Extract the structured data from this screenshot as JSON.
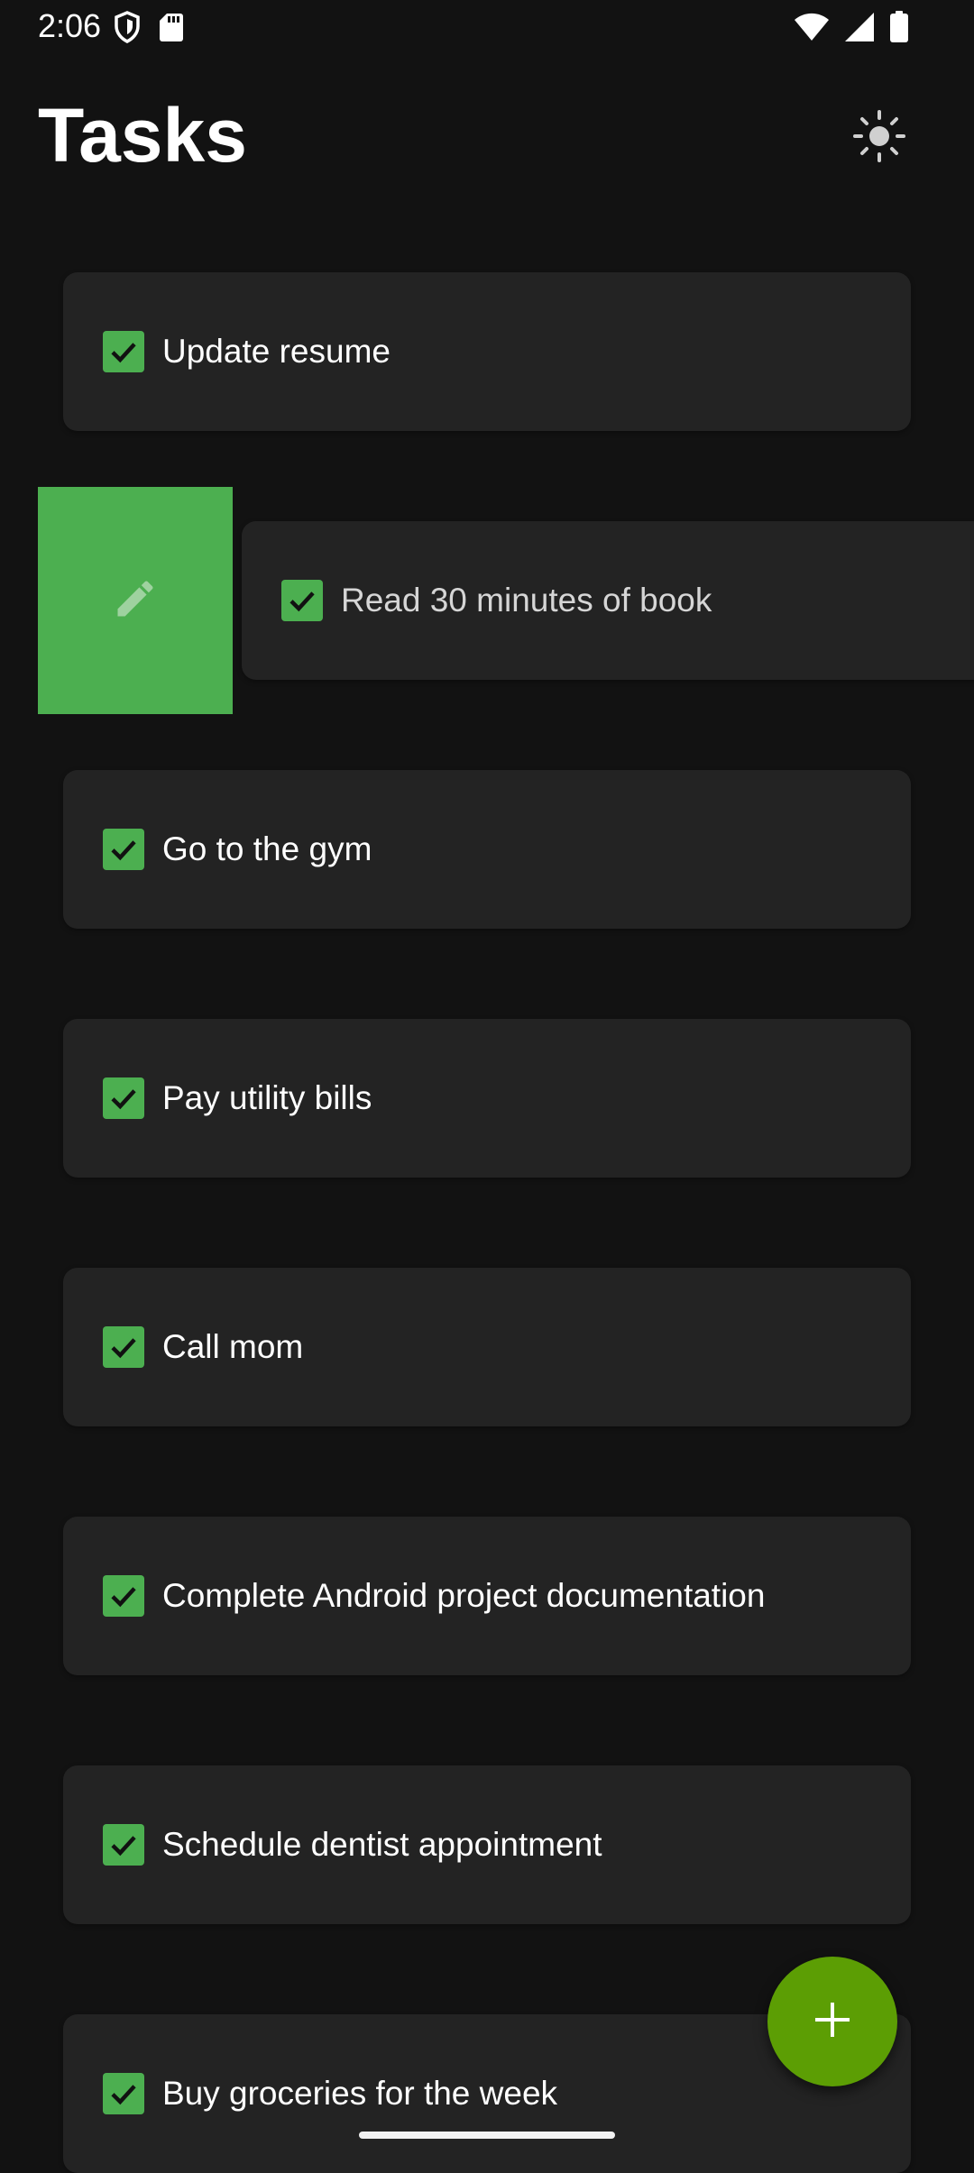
{
  "status_bar": {
    "time": "2:06",
    "left_icons": [
      "shield-icon",
      "sd-card-icon"
    ],
    "right_icons": [
      "wifi-icon",
      "signal-icon",
      "battery-icon"
    ]
  },
  "header": {
    "title": "Tasks",
    "theme_icon": "sun-icon"
  },
  "tasks": [
    {
      "label": "Update resume",
      "checked": true
    },
    {
      "label": "Read 30 minutes of book",
      "checked": true,
      "swiped": true
    },
    {
      "label": "Go to the gym",
      "checked": true
    },
    {
      "label": "Pay utility bills",
      "checked": true
    },
    {
      "label": "Call mom",
      "checked": true
    },
    {
      "label": "Complete Android project documentation",
      "checked": true
    },
    {
      "label": "Schedule dentist appointment",
      "checked": true
    },
    {
      "label": "Buy groceries for the week",
      "checked": true
    }
  ],
  "swipe_action": {
    "icon": "edit-icon",
    "color": "#4caf50"
  },
  "fab": {
    "icon": "plus-icon",
    "color": "#5c9e04"
  },
  "colors": {
    "background": "#121212",
    "card": "#232323",
    "checkbox": "#4caf50"
  }
}
